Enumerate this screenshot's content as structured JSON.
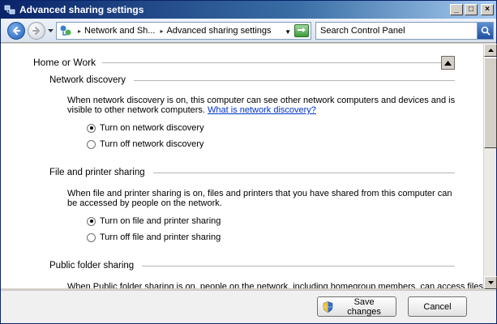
{
  "window": {
    "title": "Advanced sharing settings",
    "buttons": {
      "minimize": "_",
      "maximize": "□",
      "close": "×"
    }
  },
  "address_bar": {
    "breadcrumbs": [
      "Network and Sh...",
      "Advanced sharing settings"
    ],
    "search_placeholder": "Search Control Panel"
  },
  "content": {
    "group_title": "Home or Work",
    "sections": [
      {
        "title": "Network discovery",
        "description": "When network discovery is on, this computer can see other network computers and devices and is visible to other network computers.",
        "link": "What is network discovery?",
        "options": [
          {
            "label": "Turn on network discovery",
            "checked": true
          },
          {
            "label": "Turn off network discovery",
            "checked": false
          }
        ]
      },
      {
        "title": "File and printer sharing",
        "description": "When file and printer sharing is on, files and printers that you have shared from this computer can be accessed by people on the network.",
        "options": [
          {
            "label": "Turn on file and printer sharing",
            "checked": true
          },
          {
            "label": "Turn off file and printer sharing",
            "checked": false
          }
        ]
      },
      {
        "title": "Public folder sharing",
        "description": "When Public folder sharing is on, people on the network, including homegroup members, can access files in"
      }
    ]
  },
  "footer": {
    "save_label": "Save changes",
    "cancel_label": "Cancel"
  },
  "colors": {
    "accent": "#0a246a",
    "link": "#0033cc"
  },
  "icons": [
    "network-icon",
    "back-arrow-icon",
    "forward-arrow-icon",
    "refresh-icon",
    "search-icon",
    "shield-icon",
    "collapse-arrow-icon"
  ]
}
